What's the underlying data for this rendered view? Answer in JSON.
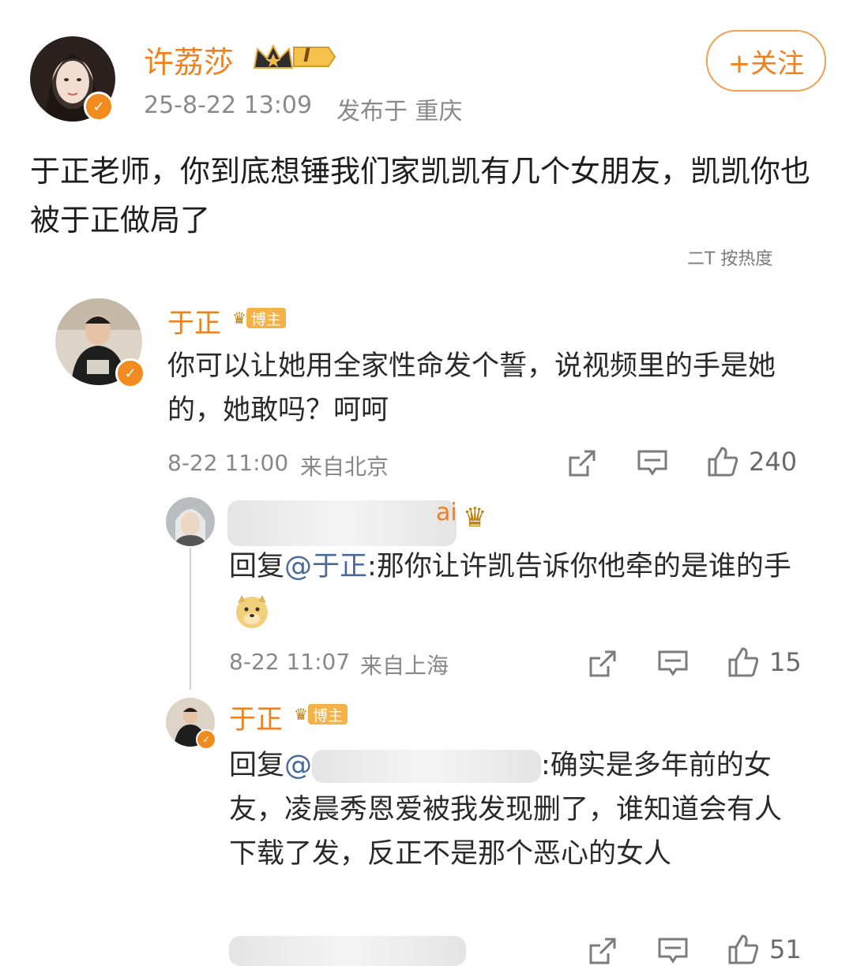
{
  "post": {
    "author": "许荔莎",
    "level": "I",
    "timestamp": "25-8-22 13:09",
    "location": "发布于 重庆",
    "follow_label": "+关注",
    "text": "于正老师，你到底想锤我们家凯凯有几个女朋友，凯凯你也被于正做局了",
    "sort_label": "二T 按热度"
  },
  "comments": [
    {
      "author": "于正",
      "badge": "博主",
      "text": "你可以让她用全家性命发个誓，说视频里的手是她的，她敢吗？呵呵",
      "time": "8-22 11:00",
      "location": "来自北京",
      "likes": "240"
    },
    {
      "author_fragment": "ai",
      "text_prefix": "回复",
      "mention": "@于正",
      "text": ":那你让许凯告诉你他牵的是谁的手",
      "time": "8-22 11:07",
      "location": "来自上海",
      "likes": "15"
    },
    {
      "author": "于正",
      "badge": "博主",
      "text_prefix": "回复",
      "mention": "@",
      "text": ":确实是多年前的女友，凌晨秀恩爱被我发现删了，谁知道会有人下载了发，反正不是那个恶心的女人",
      "likes": "51"
    }
  ],
  "icons": {
    "share": "share-icon",
    "comment": "comment-icon",
    "like": "like-icon",
    "crown": "crown-icon",
    "verified": "verified-icon"
  },
  "colors": {
    "accent": "#f0801e",
    "badge": "#f6b24a",
    "meta": "#8a8a8a"
  }
}
